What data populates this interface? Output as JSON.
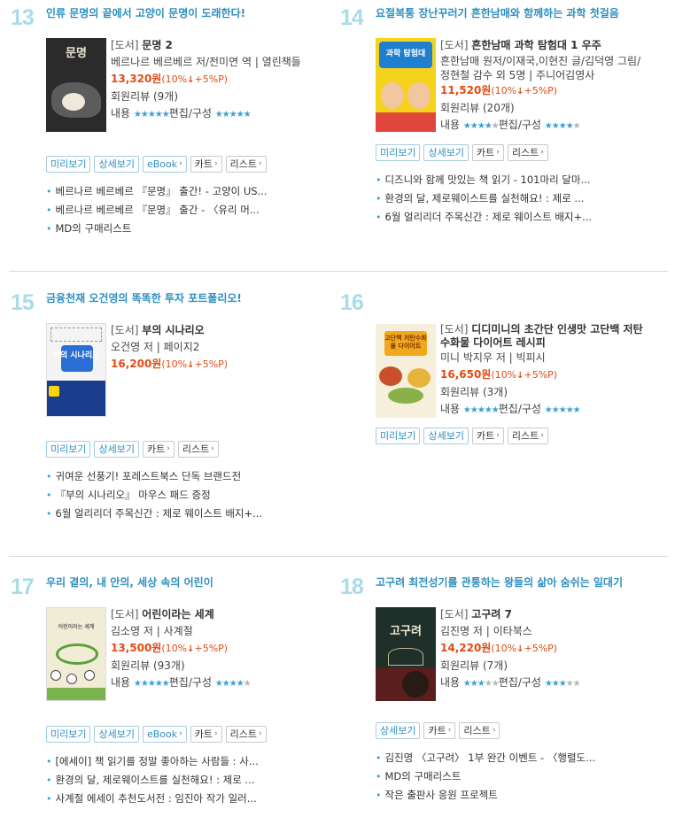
{
  "books": [
    {
      "rank": "13",
      "headline": "인류 문명의 끝에서 고양이 문명이 도래한다!",
      "category": "[도서]",
      "title": "문명 2",
      "authors": "베르나르 베르베르 저/전미연 역 | 열린책들",
      "price": "13,320원",
      "discount": "(10%",
      "discount_arrow": "↓",
      "point": "+5%P)",
      "review": "회원리뷰 (9개)",
      "content_label": "내용",
      "content_stars": 5,
      "edit_label": "편집/구성",
      "edit_stars": 5,
      "cover_text": "문명",
      "buttons": [
        "미리보기",
        "상세보기",
        "eBook",
        "카트",
        "리스트"
      ],
      "events": [
        "베르나르 베르베르 『문명』 출간! - 고양이 US...",
        "베르나르 베르베르 『문명』 출간 - 〈유리 머...",
        "MD의 구매리스트"
      ]
    },
    {
      "rank": "14",
      "headline": "요절복통 장난꾸러기 흔한남매와 함께하는 과학 첫걸음",
      "category": "[도서]",
      "title": "흔한남매 과학 탐험대 1 우주",
      "authors": "흔한남매 원저/이재국,이현진 글/김덕영 그림/정현철 감수 외 5명 | 주니어김영사",
      "price": "11,520원",
      "discount": "(10%",
      "discount_arrow": "↓",
      "point": "+5%P)",
      "review": "회원리뷰 (20개)",
      "content_label": "내용",
      "content_stars": 4,
      "edit_label": "편집/구성",
      "edit_stars": 4,
      "cover_text": "과학 탐험대",
      "buttons": [
        "미리보기",
        "상세보기",
        "카트",
        "리스트"
      ],
      "events": [
        "디즈니와 함께 맛있는 책 읽기 - 101마리 달마...",
        "환경의 달, 제로웨이스트를 실천해요! : 제로 ...",
        "6월 얼리리더 주목신간 : 제로 웨이스트 배지+..."
      ]
    },
    {
      "rank": "15",
      "headline": "금융천재 오건영의 똑똑한 투자 포트폴리오!",
      "category": "[도서]",
      "title": "부의 시나리오",
      "authors": "오건영 저 | 페이지2",
      "price": "16,200원",
      "discount": "(10%",
      "discount_arrow": "↓",
      "point": "+5%P)",
      "cover_text": "부의 시나리오",
      "buttons": [
        "미리보기",
        "상세보기",
        "카트",
        "리스트"
      ],
      "events": [
        "귀여운 선풍기! 포레스트북스 단독 브랜드전",
        "『부의 시나리오』 마우스 패드 증정",
        "6월 얼리리더 주목신간 : 제로 웨이스트 배지+..."
      ]
    },
    {
      "rank": "16",
      "headline": "",
      "category": "[도서]",
      "title": "디디미니의 초간단 인생맛 고단백 저탄수화물 다이어트 레시피",
      "authors": "미니 박지우 저 | 빅피시",
      "price": "16,650원",
      "discount": "(10%",
      "discount_arrow": "↓",
      "point": "+5%P)",
      "review": "회원리뷰 (3개)",
      "content_label": "내용",
      "content_stars": 5,
      "edit_label": "편집/구성",
      "edit_stars": 5,
      "cover_text": "고단백 저탄수화물 다이어트",
      "buttons": [
        "미리보기",
        "상세보기",
        "카트",
        "리스트"
      ],
      "events": []
    },
    {
      "rank": "17",
      "headline": "우리 곁의, 내 안의, 세상 속의 어린이",
      "category": "[도서]",
      "title": "어린이라는 세계",
      "authors": "김소영 저 | 사계절",
      "price": "13,500원",
      "discount": "(10%",
      "discount_arrow": "↓",
      "point": "+5%P)",
      "review": "회원리뷰 (93개)",
      "content_label": "내용",
      "content_stars": 5,
      "edit_label": "편집/구성",
      "edit_stars": 4,
      "cover_text": "어린이라는 세계",
      "buttons": [
        "미리보기",
        "상세보기",
        "eBook",
        "카트",
        "리스트"
      ],
      "events": [
        "[에세이] 책 읽기를 정말 좋아하는 사람들 : 사...",
        "환경의 달, 제로웨이스트를 실천해요! : 제로 ...",
        "사계절 에세이 추천도서전 : 임진아 작가 일러..."
      ]
    },
    {
      "rank": "18",
      "headline": "고구려 최전성기를 관통하는 왕들의 삶아 숨쉬는 일대기",
      "category": "[도서]",
      "title": "고구려 7",
      "authors": "김진명 저 | 이타북스",
      "price": "14,220원",
      "discount": "(10%",
      "discount_arrow": "↓",
      "point": "+5%P)",
      "review": "회원리뷰 (7개)",
      "content_label": "내용",
      "content_stars": 3,
      "edit_label": "편집/구성",
      "edit_stars": 3,
      "cover_text": "고구려",
      "buttons": [
        "상세보기",
        "카트",
        "리스트"
      ],
      "events": [
        "김진명 〈고구려〉 1부 완간 이벤트 - 〈행렬도...",
        "MD의 구매리스트",
        "작은 출판사 응원 프로젝트"
      ]
    }
  ],
  "colors": {
    "rank": "#a9dbe8",
    "headline": "#2e8fbf",
    "price": "#e14b14",
    "star_on": "#3ba0d6",
    "star_off": "#b5b5b5"
  }
}
